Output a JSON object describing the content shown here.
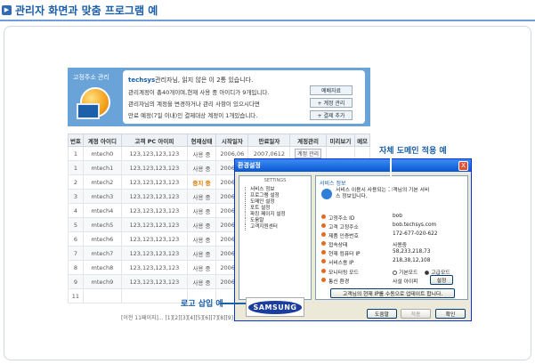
{
  "page": {
    "title": "관리자 화면과 맞춤 프로그램 예"
  },
  "admin": {
    "header_title": "고정주소 관리",
    "notice": {
      "line1_brand": "techsys",
      "line1_rest": "관리자님, 읽지 않은 이 2통 있습니다.",
      "line2": "관리계정이 총40개이며,현재 사용 중 아이디가 9개입니다.",
      "line3": "관리자님의 계정을 변경하거나 관리 사항이 있으시다면",
      "line4": "만료 예정(7일 이내)인 결제대상 계정이 1개있습니다.",
      "btn_reserve": "예배자료",
      "btn_add_account": "+ 계정 관리",
      "btn_extend": "+ 결제 추가"
    },
    "table": {
      "headers": [
        "번호",
        "계정 아이디",
        "고객 PC 아이피",
        "현재상태",
        "시작일자",
        "만료일자",
        "계정관리",
        "미리보기",
        "메모"
      ],
      "rows": [
        [
          "1",
          "mtech0",
          "123,123,123,123",
          "사용 중",
          "2006,06",
          "2007,0612",
          "계정 관리",
          "",
          ""
        ],
        [
          "1",
          "mtech1",
          "123,123,123,123",
          "사용 중",
          "2006,06",
          "",
          "",
          "",
          ""
        ],
        [
          "2",
          "mtech2",
          "123,123,123,123",
          "중지 중",
          "2006,06",
          "",
          "",
          "",
          ""
        ],
        [
          "3",
          "mtech3",
          "123,123,123,123",
          "사용 중",
          "2006,06",
          "",
          "",
          "",
          ""
        ],
        [
          "4",
          "mtech4",
          "123,123,123,123",
          "사용 중",
          "2006,06",
          "",
          "",
          "",
          ""
        ],
        [
          "5",
          "mtech5",
          "123,123,123,123",
          "사용 중",
          "2006,06",
          "",
          "",
          "",
          ""
        ],
        [
          "6",
          "mtech6",
          "123,123,123,123",
          "사용 중",
          "2006,06",
          "",
          "",
          "",
          ""
        ],
        [
          "7",
          "mtech7",
          "123,123,123,123",
          "사용 중",
          "2006,06",
          "",
          "",
          "",
          ""
        ],
        [
          "8",
          "mtech8",
          "123,123,123,123",
          "사용 중",
          "2006,06",
          "",
          "",
          "",
          ""
        ],
        [
          "9",
          "mtech9",
          "123,123,123,123",
          "사용 중",
          "2006,06",
          "",
          "",
          "",
          ""
        ],
        [
          "11",
          "",
          "",
          "",
          "",
          "",
          "",
          "",
          ""
        ]
      ]
    },
    "pager": "[이전 11페이지]... [1][2][3][4][5][6][7][8][9]"
  },
  "dialog": {
    "title": "환경설정",
    "close": "X",
    "left_header": "SETTINGS",
    "tree": [
      "서비스 정보",
      "프로그램 설정",
      "도메인 설정",
      "포트 설정",
      "파킹 페이지 설정",
      "도움말",
      "고객지원센터"
    ],
    "svc_header": "서비스 정보",
    "svc_message": "서비스 이용시 사용되는 고객님의 기본 서비스 정보입니다.",
    "fields": [
      {
        "k": "고정주소 ID",
        "v": "bob"
      },
      {
        "k": "고객 고정주소",
        "v": "bob.techsys.com"
      },
      {
        "k": "제품 인증번호",
        "v": "172-677-020-622"
      },
      {
        "k": "접속상태",
        "v": "사용중"
      },
      {
        "k": "현재 컴퓨터 IP",
        "v": "58,233,218,73"
      },
      {
        "k": "서비스용 IP",
        "v": "218,38,12,108"
      }
    ],
    "monitor_mode_label": "모니터링 모드",
    "monitor_opt1": "기본모드",
    "monitor_opt2": "고급모드",
    "env_label": "통신 환경",
    "env_value": "사설 아이피",
    "env_button": "설정",
    "update_button": "고객님의 현재 IP를 수동으로 업데이트 합니다.",
    "btn_help": "도움말",
    "btn_apply": "적용",
    "btn_ok": "확인"
  },
  "callouts": {
    "domain_example": "자체 도메인 적용 예",
    "logo_example": "로고 삽입 예"
  },
  "logo": {
    "text": "SAMSUNG"
  }
}
